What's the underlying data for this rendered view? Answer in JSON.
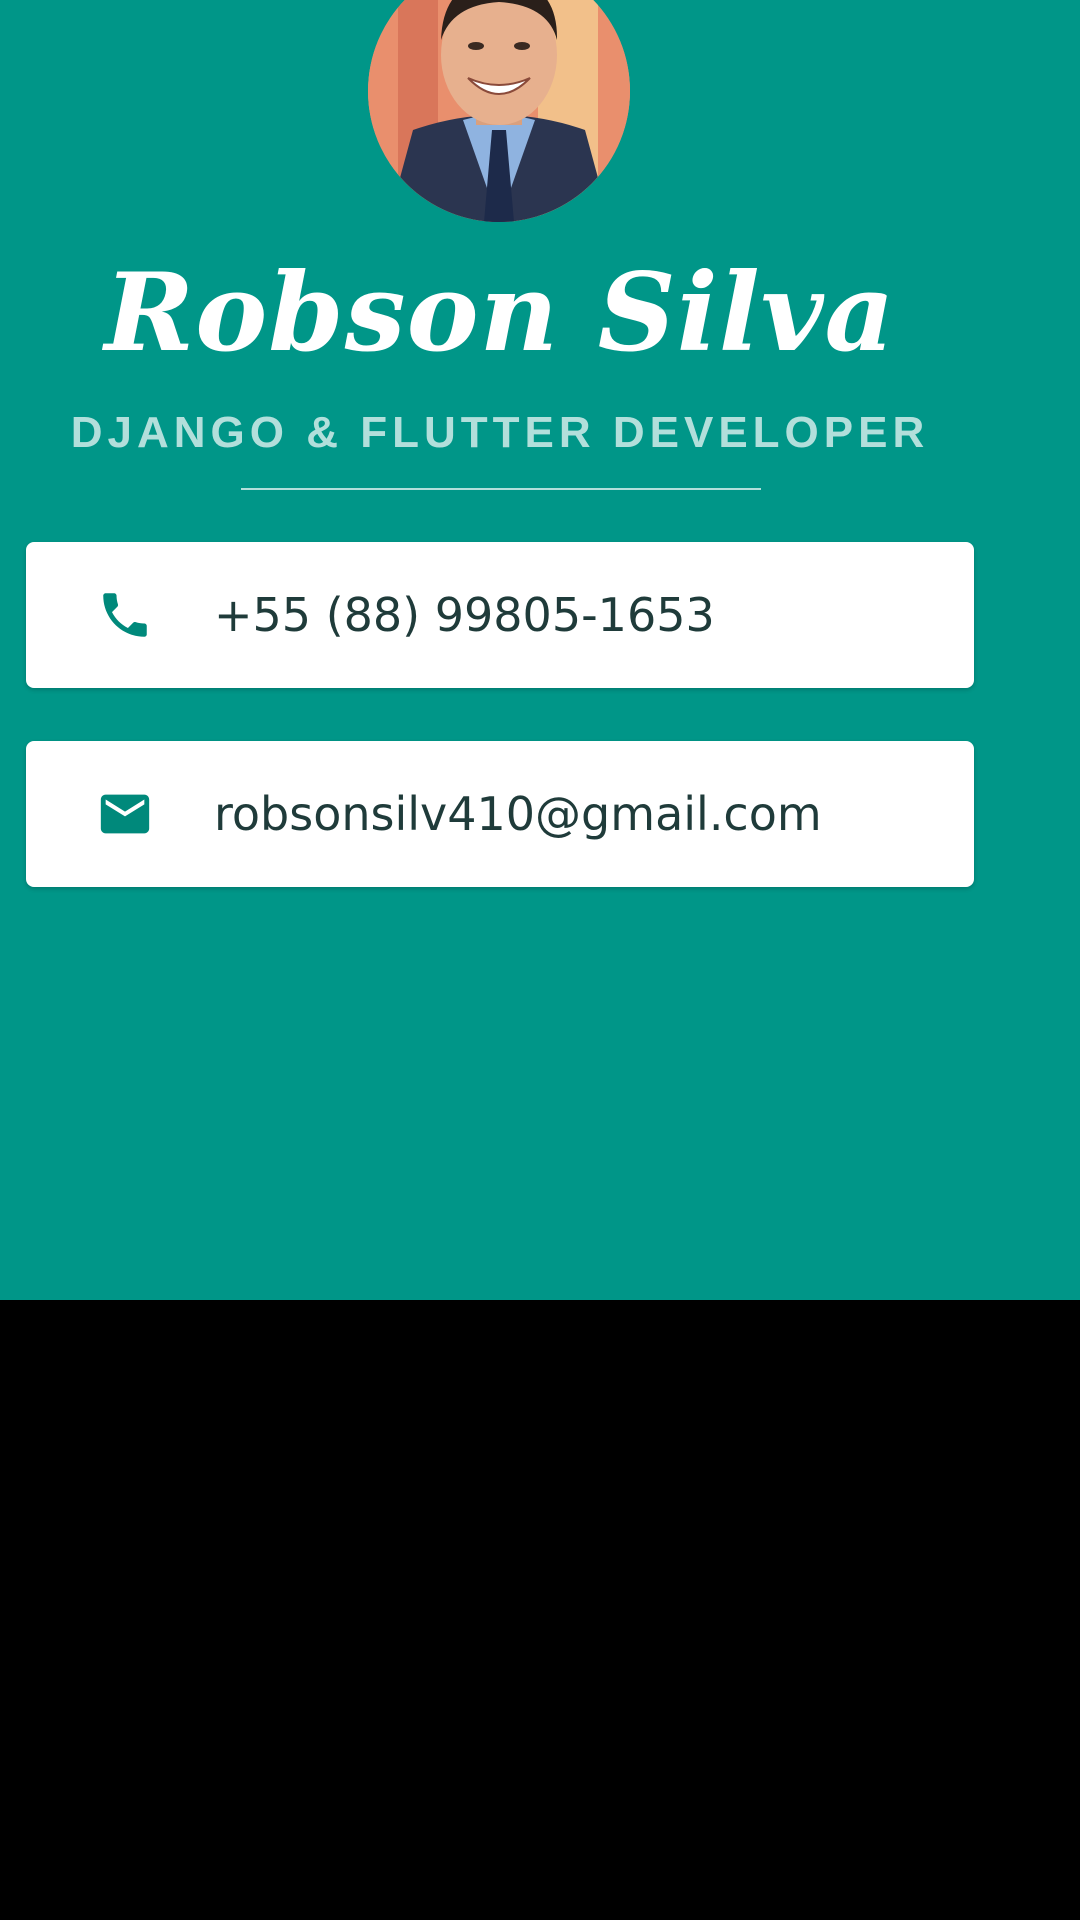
{
  "profile": {
    "name": "Robson Silva",
    "title": "DJANGO & FLUTTER DEVELOPER",
    "avatar_icon": "profile-photo"
  },
  "contacts": [
    {
      "icon": "phone-icon",
      "value": "+55 (88) 99805-1653"
    },
    {
      "icon": "mail-icon",
      "value": "robsonsilv410@gmail.com"
    }
  ],
  "colors": {
    "background": "#009688",
    "card": "#ffffff",
    "accent": "#00897b",
    "subtitle": "#b2dfdb",
    "text": "#1f3b3a",
    "letterbox": "#000000"
  }
}
